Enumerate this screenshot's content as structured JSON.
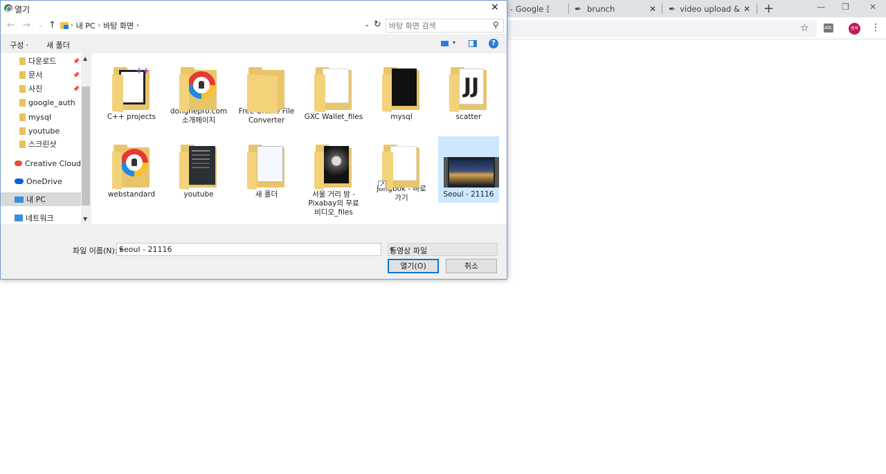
{
  "browser": {
    "tabs": [
      {
        "label": "- Google 문서",
        "close": "✕"
      },
      {
        "label": "brunch",
        "close": "✕"
      },
      {
        "label": "video upload & c",
        "close": "✕"
      }
    ],
    "new_tab": "+",
    "profile_label": "종북",
    "ext_label": "ABC"
  },
  "dialog": {
    "title": "열기",
    "close": "✕",
    "breadcrumb": [
      "내 PC",
      "바탕 화면"
    ],
    "search_placeholder": "바탕 화면 검색",
    "toolbar": {
      "organize": "구성 ·",
      "new_folder": "새 폴더",
      "help": "?"
    },
    "nav_items": [
      {
        "label": "다운로드",
        "icon": "download-folder-icon",
        "pinned": true
      },
      {
        "label": "문서",
        "icon": "documents-folder-icon",
        "pinned": true
      },
      {
        "label": "사진",
        "icon": "pictures-folder-icon",
        "pinned": true
      },
      {
        "label": "google_auth",
        "icon": "folder-icon",
        "pinned": false
      },
      {
        "label": "mysql",
        "icon": "folder-icon",
        "pinned": false
      },
      {
        "label": "youtube",
        "icon": "folder-icon",
        "pinned": false
      },
      {
        "label": "스크린샷",
        "icon": "folder-icon",
        "pinned": false
      },
      {
        "label": "Creative Cloud Fil",
        "icon": "creative-cloud-icon",
        "pinned": false
      },
      {
        "label": "OneDrive",
        "icon": "onedrive-icon",
        "pinned": false
      },
      {
        "label": "내 PC",
        "icon": "this-pc-icon",
        "pinned": false,
        "selected": true
      },
      {
        "label": "네트워크",
        "icon": "network-icon",
        "pinned": false
      }
    ],
    "files": [
      {
        "label": "C++ projects",
        "kind": "cpp"
      },
      {
        "label": "dongnepro.com\n소개페이지",
        "kind": "lock"
      },
      {
        "label": "Free Online File\nConverter",
        "kind": "plain"
      },
      {
        "label": "GXC Wallet_files",
        "kind": "paper"
      },
      {
        "label": "mysql",
        "kind": "black"
      },
      {
        "label": "scatter",
        "kind": "scatter"
      },
      {
        "label": "webstandard",
        "kind": "lock"
      },
      {
        "label": "youtube",
        "kind": "dark"
      },
      {
        "label": "새 폴더",
        "kind": "web"
      },
      {
        "label": "서울 거리 밤 -\nPixabay의 무료\n비디오_files",
        "kind": "night"
      },
      {
        "label": "jongbok - 바로\n가기",
        "kind": "shortcut"
      },
      {
        "label": "Seoul - 21116",
        "kind": "video",
        "selected": true
      }
    ],
    "filename_label": "파일 이름(N):",
    "filename_value": "Seoul - 21116",
    "filetype_value": "동영상 파일",
    "open_button": "열기(O)",
    "cancel_button": "취소"
  },
  "colors": {
    "accent": "#0078d7",
    "selection": "#cce8ff",
    "folder": "#e9c56a"
  }
}
